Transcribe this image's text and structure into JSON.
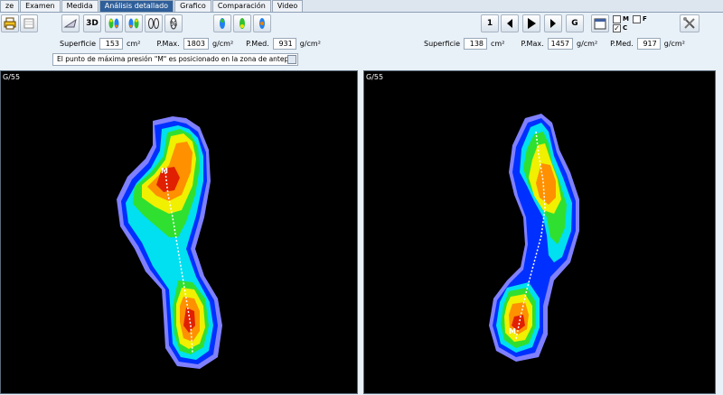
{
  "tabs": [
    {
      "label": "ze"
    },
    {
      "label": "Examen"
    },
    {
      "label": "Medida"
    },
    {
      "label": "Análisis detallado",
      "active": true
    },
    {
      "label": "Grafico"
    },
    {
      "label": "Comparación"
    },
    {
      "label": "Video"
    }
  ],
  "toolbar": {
    "view3d_label": "3D",
    "page_label": "1",
    "grid_label": "G",
    "check_m_label": "M",
    "check_f_label": "F",
    "check_c_label": "C",
    "check_c_mark": "✓"
  },
  "left": {
    "superficie_label": "Superficie",
    "superficie_value": "153",
    "superficie_unit": "cm²",
    "pmax_label": "P.Max.",
    "pmax_value": "1803",
    "pmax_unit": "g/cm²",
    "pmed_label": "P.Med.",
    "pmed_value": "931",
    "pmed_unit": "g/cm²",
    "message": "El punto de máxima presión \"M\" es posicionado en la zona de antepié",
    "panel_label": "G/55",
    "marker_label": "M"
  },
  "right": {
    "superficie_label": "Superficie",
    "superficie_value": "138",
    "superficie_unit": "cm²",
    "pmax_label": "P.Max.",
    "pmax_value": "1457",
    "pmax_unit": "g/cm²",
    "pmed_label": "P.Med.",
    "pmed_value": "917",
    "pmed_unit": "g/cm²",
    "panel_label": "G/55",
    "marker_label": "M"
  },
  "colors": {
    "tab_active": "#2f5f9a",
    "background": "#e8f0f8",
    "pressure_low": "#8080ff",
    "pressure_blue": "#0030ff",
    "pressure_cyan": "#00e0f0",
    "pressure_green": "#30e030",
    "pressure_yellow": "#f0f000",
    "pressure_orange": "#ff9000",
    "pressure_red": "#e02000"
  },
  "icons": [
    "printer-icon",
    "eraser-icon",
    "view-3d-button",
    "feet-icon",
    "percent-icon",
    "first-page-icon",
    "prev-icon",
    "play-icon",
    "next-icon",
    "grid-icon",
    "calendar-icon",
    "tools-icon"
  ]
}
